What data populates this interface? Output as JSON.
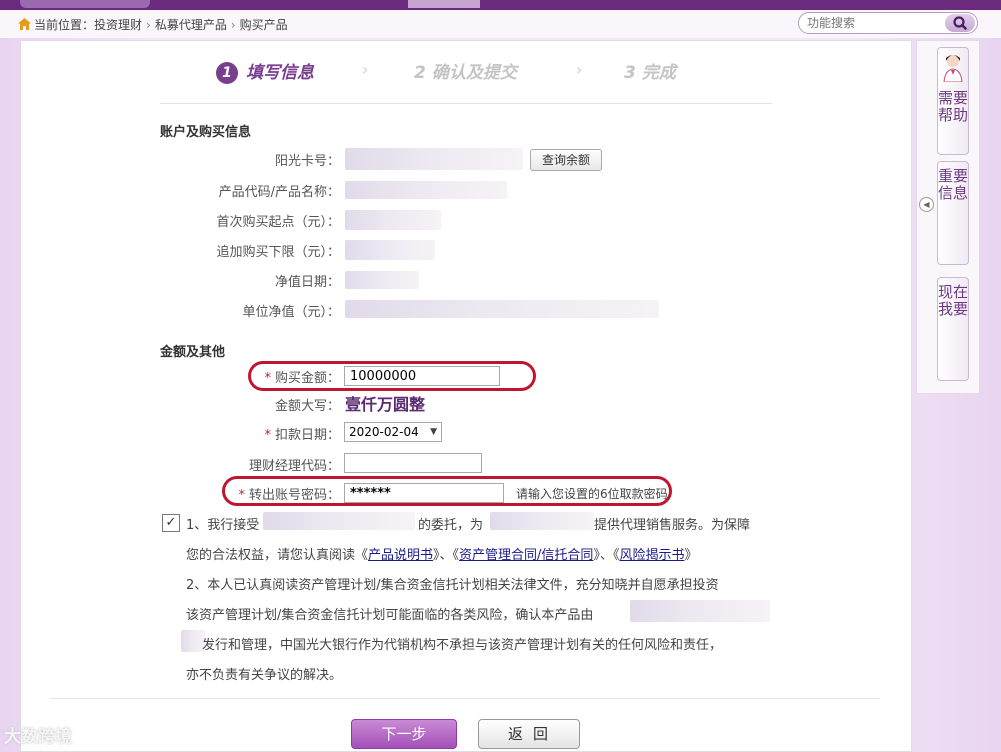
{
  "breadcrumb": {
    "prefix": "当前位置：",
    "items": [
      "投资理财",
      "私募代理产品",
      "购买产品"
    ]
  },
  "search": {
    "placeholder": "功能搜索"
  },
  "steps": [
    {
      "num": "1",
      "label": "填写信息"
    },
    {
      "num": "2",
      "label": "确认及提交"
    },
    {
      "num": "3",
      "label": "完成"
    }
  ],
  "account_section": {
    "title": "账户及购买信息",
    "fields": {
      "card": "阳光卡号：",
      "product": "产品代码/产品名称：",
      "first_min": "首次购买起点（元）：",
      "add_limit": "追加购买下限（元）：",
      "nav_date": "净值日期：",
      "unit_nav": "单位净值（元）："
    },
    "query_button": "查询余额"
  },
  "amount_section": {
    "title": "金额及其他",
    "amount_label": "购买金额：",
    "amount_value": "10000000",
    "amount_cn_label": "金额大写：",
    "amount_cn_value": "壹仟万圆整",
    "debit_date_label": "扣款日期：",
    "debit_date_value": "2020-02-04",
    "manager_label": "理财经理代码：",
    "manager_value": "",
    "password_label": "转出账号密码：",
    "password_value": "******",
    "password_hint": "请输入您设置的6位取款密码"
  },
  "agreement": {
    "p1a": "1、我行接受",
    "p1b": "的委托，为",
    "p1c": "提供代理销售服务。为保障",
    "p2a": "您的合法权益，请您认真阅读《",
    "link1": "产品说明书",
    "p2b": "》、《",
    "link2": "资产管理合同/信托合同",
    "p2c": "》、《",
    "link3": "风险揭示书",
    "p2d": "》",
    "p3": "2、本人已认真阅读资产管理计划/集合资金信托计划相关法律文件，充分知晓并自愿承担投资",
    "p4": "该资产管理计划/集合资金信托计划可能面临的各类风险，确认本产品由",
    "p5": "发行和管理，中国光大银行作为代销机构不承担与该资产管理计划有关的任何风险和责任，",
    "p6": "亦不负责有关争议的解决。"
  },
  "buttons": {
    "next": "下一步",
    "back": "返回"
  },
  "side": {
    "help": "需要帮助",
    "important": "重要信息",
    "want": "现在我要"
  },
  "watermark": "大数跨境"
}
